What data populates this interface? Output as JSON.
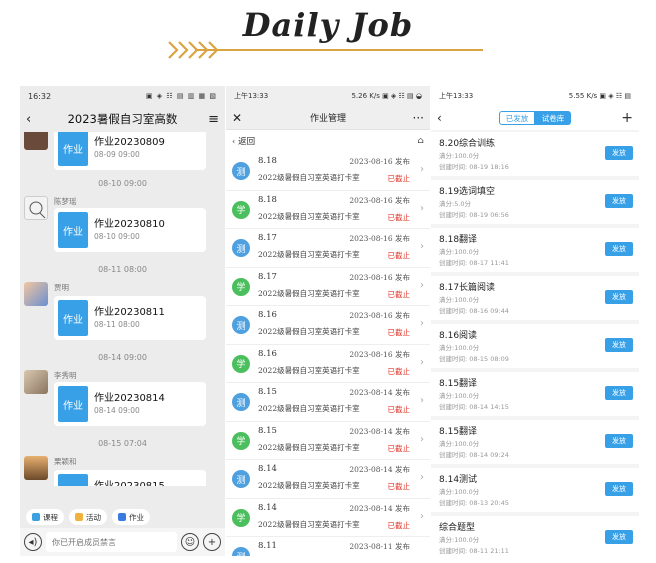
{
  "header": {
    "title": "Daily Job"
  },
  "panel1": {
    "status_time": "16:32",
    "status_icons": "▣ ◈ ☷ ▤ ▥ ▦ ▧",
    "nav_title": "2023暑假自习室高数",
    "blocks": [
      {
        "time": "",
        "sender": "",
        "card_icon": "作业",
        "card_title": "作业20230809",
        "card_date": "08-09 09:00"
      },
      {
        "time": "08-10 09:00",
        "sender": "陈梦瑶",
        "card_icon": "作业",
        "card_title": "作业20230810",
        "card_date": "08-10 09:00"
      },
      {
        "time": "08-11 08:00",
        "sender": "贾明",
        "card_icon": "作业",
        "card_title": "作业20230811",
        "card_date": "08-11 08:00"
      },
      {
        "time": "08-14 09:00",
        "sender": "李秀明",
        "card_icon": "作业",
        "card_title": "作业20230814",
        "card_date": "08-14 09:00"
      },
      {
        "time": "08-15 07:04",
        "sender": "栗颖和",
        "card_icon": "作业",
        "card_title": "作业20230815",
        "card_date": ""
      }
    ],
    "toolbar": {
      "course": "课程",
      "activity": "活动",
      "homework": "作业"
    },
    "input_placeholder": "你已开启成员禁言"
  },
  "panel2": {
    "status_left": "5.26 K/s",
    "status_right": "▣ ◈ ☷ ▤ ◒",
    "nav_title": "作业管理",
    "back_label": "返回",
    "rows": [
      {
        "badge": "测",
        "title": "8.18",
        "date": "2023-08-16 发布",
        "desc": "2022级暑假自习室英语打卡室",
        "status": "已截止"
      },
      {
        "badge": "学",
        "title": "8.18",
        "date": "2023-08-16 发布",
        "desc": "2022级暑假自习室英语打卡室",
        "status": "已截止"
      },
      {
        "badge": "测",
        "title": "8.17",
        "date": "2023-08-16 发布",
        "desc": "2022级暑假自习室英语打卡室",
        "status": "已截止"
      },
      {
        "badge": "学",
        "title": "8.17",
        "date": "2023-08-16 发布",
        "desc": "2022级暑假自习室英语打卡室",
        "status": "已截止"
      },
      {
        "badge": "测",
        "title": "8.16",
        "date": "2023-08-16 发布",
        "desc": "2022级暑假自习室英语打卡室",
        "status": "已截止"
      },
      {
        "badge": "学",
        "title": "8.16",
        "date": "2023-08-16 发布",
        "desc": "2022级暑假自习室英语打卡室",
        "status": "已截止"
      },
      {
        "badge": "测",
        "title": "8.15",
        "date": "2023-08-14 发布",
        "desc": "2022级暑假自习室英语打卡室",
        "status": "已截止"
      },
      {
        "badge": "学",
        "title": "8.15",
        "date": "2023-08-14 发布",
        "desc": "2022级暑假自习室英语打卡室",
        "status": "已截止"
      },
      {
        "badge": "测",
        "title": "8.14",
        "date": "2023-08-14 发布",
        "desc": "2022级暑假自习室英语打卡室",
        "status": "已截止"
      },
      {
        "badge": "学",
        "title": "8.14",
        "date": "2023-08-14 发布",
        "desc": "2022级暑假自习室英语打卡室",
        "status": "已截止"
      },
      {
        "badge": "测",
        "title": "8.11",
        "date": "2023-08-11 发布",
        "desc": "",
        "status": ""
      }
    ]
  },
  "panel3": {
    "status_left": "上午13:33",
    "status_right": "5.55 K/s ▣ ◈ ☷ ▤",
    "seg_sent": "已发放",
    "seg_library": "试卷库",
    "button_label": "发放",
    "items": [
      {
        "title": "8.20综合训练",
        "score": "满分:100.0分",
        "time": "创建时间: 08-19 18:16"
      },
      {
        "title": "8.19选词填空",
        "score": "满分:5.0分",
        "time": "创建时间: 08-19 06:56"
      },
      {
        "title": "8.18翻译",
        "score": "满分:100.0分",
        "time": "创建时间: 08-17 11:41"
      },
      {
        "title": "8.17长篇阅读",
        "score": "满分:100.0分",
        "time": "创建时间: 08-16 09:44"
      },
      {
        "title": "8.16阅读",
        "score": "满分:100.0分",
        "time": "创建时间: 08-15 08:09"
      },
      {
        "title": "8.15翻译",
        "score": "满分:100.0分",
        "time": "创建时间: 08-14 14:15"
      },
      {
        "title": "8.15翻译",
        "score": "满分:100.0分",
        "time": "创建时间: 08-14 09:24"
      },
      {
        "title": "8.14测试",
        "score": "满分:100.0分",
        "time": "创建时间: 08-13 20:45"
      },
      {
        "title": "综合题型",
        "score": "满分:100.0分",
        "time": "创建时间: 08-11 21:11"
      }
    ]
  }
}
